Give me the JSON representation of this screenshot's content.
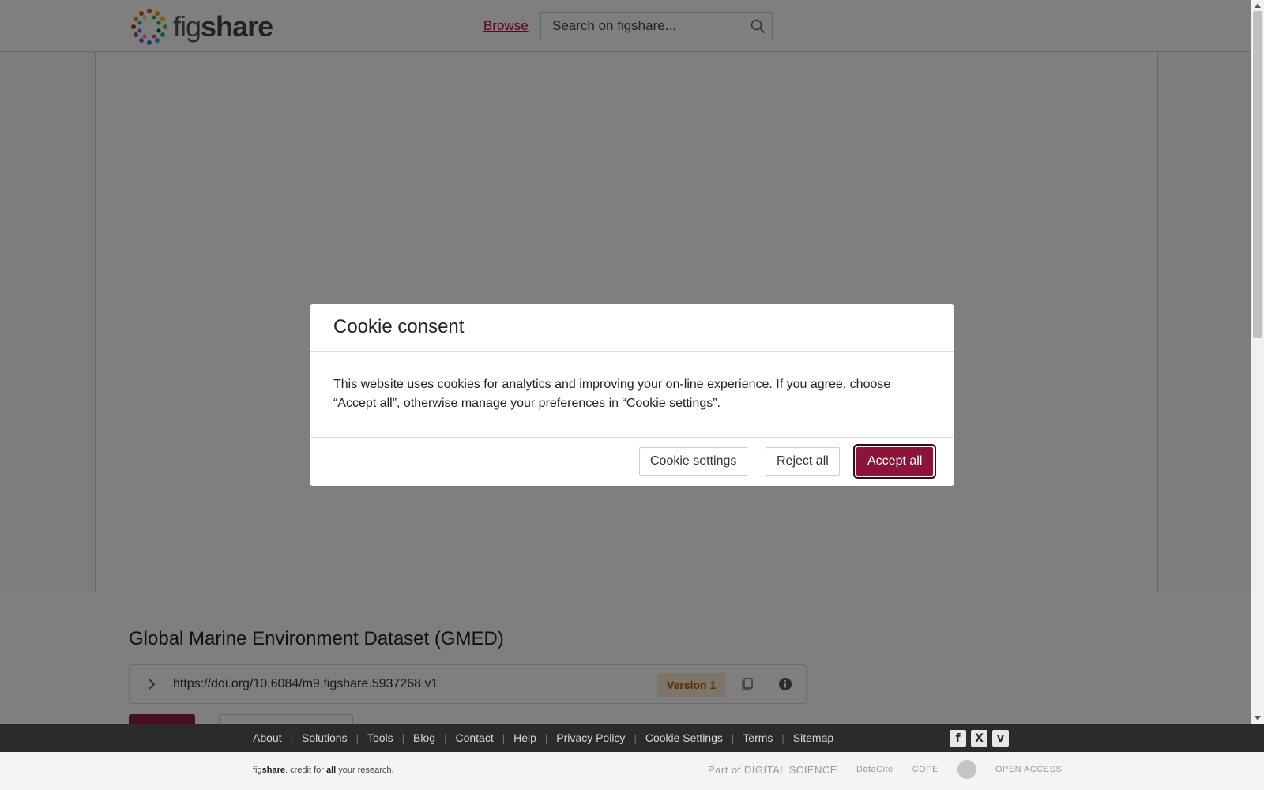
{
  "header": {
    "logo_fig": "fig",
    "logo_share": "share",
    "browse_label": "Browse",
    "search_placeholder": "Search on figshare..."
  },
  "item": {
    "title": "Global Marine Environment Dataset (GMED)",
    "doi": "https://doi.org/10.6084/m9.figshare.5937268.v1",
    "version": "Version 1"
  },
  "footer": {
    "links": [
      "About",
      "Solutions",
      "Tools",
      "Blog",
      "Contact",
      "Help",
      "Privacy Policy",
      "Cookie Settings",
      "Terms",
      "Sitemap"
    ],
    "tagline_pre": "fig",
    "tagline_bold": "share",
    "tagline_mid": ". credit for ",
    "tagline_all": "all",
    "tagline_post": " your research.",
    "social": [
      "facebook-icon",
      "x-icon",
      "vimeo-icon"
    ],
    "partners": {
      "digital_science": "Part of DIGITAL SCIENCE",
      "datacite": "DataCite",
      "cope": "COPE",
      "open_access": "OPEN ACCESS"
    }
  },
  "modal": {
    "title": "Cookie consent",
    "text": "This website uses cookies for analytics and improving your on-line experience. If you agree, choose “Accept all”, otherwise manage your preferences in “Cookie settings”.",
    "settings_label": "Cookie settings",
    "reject_label": "Reject all",
    "accept_label": "Accept all"
  },
  "colors": {
    "brand": "#8a1538",
    "link": "#b1004f",
    "version_badge_bg": "#fbe8d5",
    "version_badge_text": "#b45309",
    "footer_dark": "#2b2b2b"
  }
}
